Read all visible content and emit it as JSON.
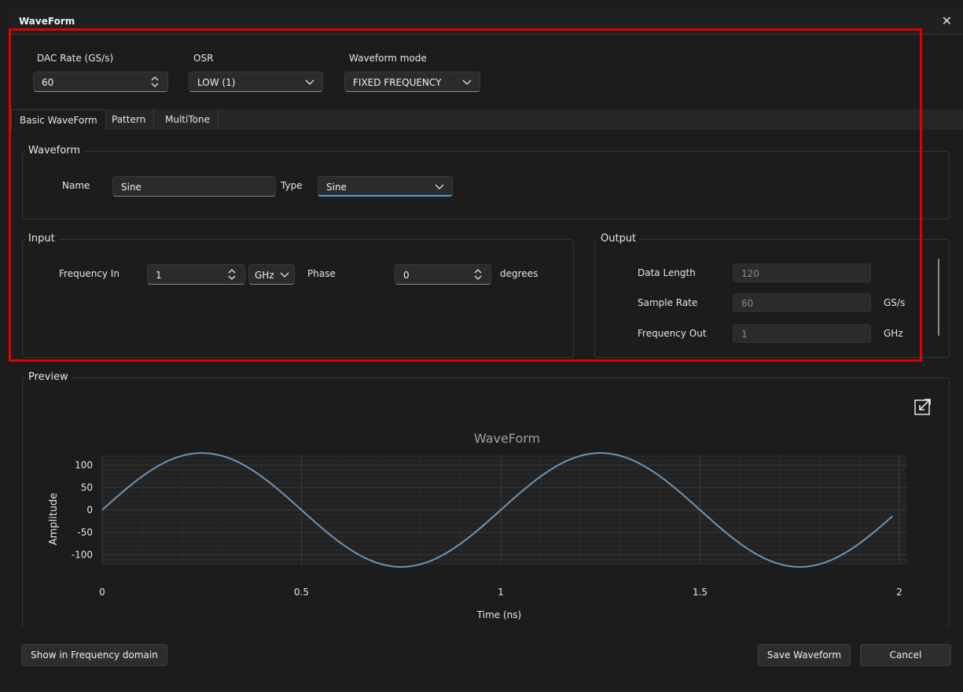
{
  "window": {
    "title": "WaveForm",
    "close_glyph": "✕"
  },
  "top": {
    "dac_rate": {
      "label": "DAC Rate (GS/s)",
      "value": "60"
    },
    "osr": {
      "label": "OSR",
      "value": "LOW (1)"
    },
    "waveform_mode": {
      "label": "Waveform mode",
      "value": "FIXED FREQUENCY"
    }
  },
  "tabs": [
    "Basic WaveForm",
    "Pattern",
    "MultiTone"
  ],
  "waveform_group": {
    "title": "Waveform",
    "name_label": "Name",
    "name_value": "Sine",
    "type_label": "Type",
    "type_value": "Sine"
  },
  "input_group": {
    "title": "Input",
    "freq_label": "Frequency In",
    "freq_value": "1",
    "freq_unit": "GHz",
    "phase_label": "Phase",
    "phase_value": "0",
    "phase_unit": "degrees"
  },
  "output_group": {
    "title": "Output",
    "data_length_label": "Data Length",
    "data_length_value": "120",
    "sample_rate_label": "Sample Rate",
    "sample_rate_value": "60",
    "sample_rate_unit": "GS/s",
    "freq_out_label": "Frequency Out",
    "freq_out_value": "1",
    "freq_out_unit": "GHz"
  },
  "preview_group": {
    "title": "Preview"
  },
  "colors": {
    "accent": "#4aa3df",
    "trace": "#6f95b4",
    "highlight": "#e00000"
  },
  "chart_data": {
    "type": "line",
    "title": "WaveForm",
    "xlabel": "Time (ns)",
    "ylabel": "Amplitude",
    "xlim": [
      0,
      2
    ],
    "ylim": [
      -127,
      127
    ],
    "xticks": [
      "0",
      "0.5",
      "1",
      "1.5",
      "2"
    ],
    "yticks": [
      "100",
      "50",
      "0",
      "-50",
      "-100"
    ],
    "grid": true,
    "series": [
      {
        "amplitude": 127,
        "frequency_ghz": 1,
        "phase_deg": 0,
        "x_start": 0,
        "x_end": 1.983,
        "samples": 120
      }
    ]
  },
  "footer": {
    "freq_domain_button": "Show in Frequency domain",
    "save_button": "Save Waveform",
    "cancel_button": "Cancel"
  }
}
